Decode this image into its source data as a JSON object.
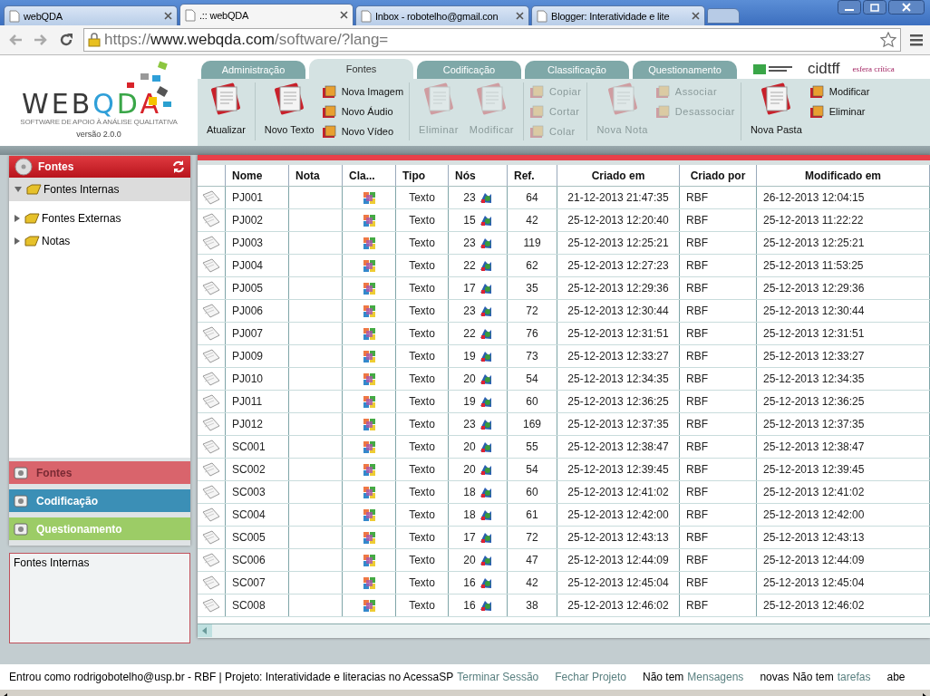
{
  "browser": {
    "tabs": [
      {
        "title": "webQDA",
        "selected": false
      },
      {
        "title": ".:: webQDA",
        "selected": true
      },
      {
        "title": "Inbox - robotelho@gmail.con",
        "selected": false
      },
      {
        "title": "Blogger: Interatividade e lite",
        "selected": false
      }
    ],
    "url": {
      "scheme": "https://",
      "host": "www.webqda.com",
      "path": "/software/?lang="
    }
  },
  "app": {
    "logo": {
      "letters": [
        {
          "text": "WEB",
          "color": "#3a3a3a"
        },
        {
          "text": "Q",
          "color": "#2f9fd8"
        },
        {
          "text": "D",
          "color": "#3aa648"
        },
        {
          "text": "A",
          "color": "#d8232a"
        }
      ],
      "subtitle": "SOFTWARE DE APOIO À ANÁLISE QUALITATIVA",
      "version": "versão 2.0.0"
    },
    "tabs": [
      {
        "label": "Administração",
        "selected": false
      },
      {
        "label": "Fontes",
        "selected": true
      },
      {
        "label": "Codificação",
        "selected": false
      },
      {
        "label": "Classificação",
        "selected": false
      },
      {
        "label": "Questionamento",
        "selected": false
      }
    ],
    "toolbar": [
      {
        "items": [
          {
            "kind": "large",
            "label": "Atualizar",
            "disabled": false
          }
        ]
      },
      {
        "items": [
          {
            "kind": "large",
            "label": "Novo Texto",
            "disabled": false
          },
          {
            "kind": "stack",
            "buttons": [
              {
                "label": "Nova Imagem",
                "disabled": false
              },
              {
                "label": "Novo Áudio",
                "disabled": false
              },
              {
                "label": "Novo Vídeo",
                "disabled": false
              }
            ]
          }
        ]
      },
      {
        "items": [
          {
            "kind": "large",
            "label": "Eliminar",
            "disabled": true
          },
          {
            "kind": "large",
            "label": "Modificar",
            "disabled": true
          }
        ]
      },
      {
        "items": [
          {
            "kind": "stack",
            "buttons": [
              {
                "label": "Copiar",
                "disabled": true
              },
              {
                "label": "Cortar",
                "disabled": true
              },
              {
                "label": "Colar",
                "disabled": true
              }
            ]
          }
        ]
      },
      {
        "items": [
          {
            "kind": "large",
            "label": "Nova Nota",
            "disabled": true
          },
          {
            "kind": "stack",
            "buttons": [
              {
                "label": "Associar",
                "disabled": true
              },
              {
                "label": "Desassociar",
                "disabled": true
              }
            ]
          }
        ]
      },
      {
        "items": [
          {
            "kind": "large",
            "label": "Nova Pasta",
            "disabled": false
          },
          {
            "kind": "stack",
            "buttons": [
              {
                "label": "Modificar",
                "disabled": false
              },
              {
                "label": "Eliminar",
                "disabled": false
              }
            ]
          }
        ]
      }
    ],
    "partners": [
      "cidtff",
      "esfera crítica"
    ]
  },
  "sidebar": {
    "panel": {
      "title": "Fontes"
    },
    "tree": [
      {
        "label": "Fontes Internas",
        "selected": true,
        "expanded": true
      },
      {
        "label": "Fontes Externas",
        "selected": false,
        "expanded": false
      },
      {
        "label": "Notas",
        "selected": false,
        "expanded": false
      }
    ],
    "accordion": [
      {
        "label": "Fontes",
        "color": "#d9646c",
        "active": true
      },
      {
        "label": "Codificação",
        "color": "#3b8fb6",
        "active": false
      },
      {
        "label": "Questionamento",
        "color": "#9ccc66",
        "active": false
      }
    ],
    "info": "Fontes Internas"
  },
  "table": {
    "columns": [
      "Nome",
      "Nota",
      "Cla...",
      "Tipo",
      "Nós",
      "Ref.",
      "Criado em",
      "Criado por",
      "Modificado em"
    ],
    "rows": [
      {
        "nome": "PJ001",
        "nota": "",
        "tipo": "Texto",
        "nos": "23",
        "ref": "64",
        "criado_em": "21-12-2013 21:47:35",
        "criado_por": "RBF",
        "modificado_em": "26-12-2013 12:04:15"
      },
      {
        "nome": "PJ002",
        "nota": "",
        "tipo": "Texto",
        "nos": "15",
        "ref": "42",
        "criado_em": "25-12-2013 12:20:40",
        "criado_por": "RBF",
        "modificado_em": "25-12-2013 11:22:22"
      },
      {
        "nome": "PJ003",
        "nota": "",
        "tipo": "Texto",
        "nos": "23",
        "ref": "119",
        "criado_em": "25-12-2013 12:25:21",
        "criado_por": "RBF",
        "modificado_em": "25-12-2013 12:25:21"
      },
      {
        "nome": "PJ004",
        "nota": "",
        "tipo": "Texto",
        "nos": "22",
        "ref": "62",
        "criado_em": "25-12-2013 12:27:23",
        "criado_por": "RBF",
        "modificado_em": "25-12-2013 11:53:25"
      },
      {
        "nome": "PJ005",
        "nota": "",
        "tipo": "Texto",
        "nos": "17",
        "ref": "35",
        "criado_em": "25-12-2013 12:29:36",
        "criado_por": "RBF",
        "modificado_em": "25-12-2013 12:29:36"
      },
      {
        "nome": "PJ006",
        "nota": "",
        "tipo": "Texto",
        "nos": "23",
        "ref": "72",
        "criado_em": "25-12-2013 12:30:44",
        "criado_por": "RBF",
        "modificado_em": "25-12-2013 12:30:44"
      },
      {
        "nome": "PJ007",
        "nota": "",
        "tipo": "Texto",
        "nos": "22",
        "ref": "76",
        "criado_em": "25-12-2013 12:31:51",
        "criado_por": "RBF",
        "modificado_em": "25-12-2013 12:31:51"
      },
      {
        "nome": "PJ009",
        "nota": "",
        "tipo": "Texto",
        "nos": "19",
        "ref": "73",
        "criado_em": "25-12-2013 12:33:27",
        "criado_por": "RBF",
        "modificado_em": "25-12-2013 12:33:27"
      },
      {
        "nome": "PJ010",
        "nota": "",
        "tipo": "Texto",
        "nos": "20",
        "ref": "54",
        "criado_em": "25-12-2013 12:34:35",
        "criado_por": "RBF",
        "modificado_em": "25-12-2013 12:34:35"
      },
      {
        "nome": "PJ011",
        "nota": "",
        "tipo": "Texto",
        "nos": "19",
        "ref": "60",
        "criado_em": "25-12-2013 12:36:25",
        "criado_por": "RBF",
        "modificado_em": "25-12-2013 12:36:25"
      },
      {
        "nome": "PJ012",
        "nota": "",
        "tipo": "Texto",
        "nos": "23",
        "ref": "169",
        "criado_em": "25-12-2013 12:37:35",
        "criado_por": "RBF",
        "modificado_em": "25-12-2013 12:37:35"
      },
      {
        "nome": "SC001",
        "nota": "",
        "tipo": "Texto",
        "nos": "20",
        "ref": "55",
        "criado_em": "25-12-2013 12:38:47",
        "criado_por": "RBF",
        "modificado_em": "25-12-2013 12:38:47"
      },
      {
        "nome": "SC002",
        "nota": "",
        "tipo": "Texto",
        "nos": "20",
        "ref": "54",
        "criado_em": "25-12-2013 12:39:45",
        "criado_por": "RBF",
        "modificado_em": "25-12-2013 12:39:45"
      },
      {
        "nome": "SC003",
        "nota": "",
        "tipo": "Texto",
        "nos": "18",
        "ref": "60",
        "criado_em": "25-12-2013 12:41:02",
        "criado_por": "RBF",
        "modificado_em": "25-12-2013 12:41:02"
      },
      {
        "nome": "SC004",
        "nota": "",
        "tipo": "Texto",
        "nos": "18",
        "ref": "61",
        "criado_em": "25-12-2013 12:42:00",
        "criado_por": "RBF",
        "modificado_em": "25-12-2013 12:42:00"
      },
      {
        "nome": "SC005",
        "nota": "",
        "tipo": "Texto",
        "nos": "17",
        "ref": "72",
        "criado_em": "25-12-2013 12:43:13",
        "criado_por": "RBF",
        "modificado_em": "25-12-2013 12:43:13"
      },
      {
        "nome": "SC006",
        "nota": "",
        "tipo": "Texto",
        "nos": "20",
        "ref": "47",
        "criado_em": "25-12-2013 12:44:09",
        "criado_por": "RBF",
        "modificado_em": "25-12-2013 12:44:09"
      },
      {
        "nome": "SC007",
        "nota": "",
        "tipo": "Texto",
        "nos": "16",
        "ref": "42",
        "criado_em": "25-12-2013 12:45:04",
        "criado_por": "RBF",
        "modificado_em": "25-12-2013 12:45:04"
      },
      {
        "nome": "SC008",
        "nota": "",
        "tipo": "Texto",
        "nos": "16",
        "ref": "38",
        "criado_em": "25-12-2013 12:46:02",
        "criado_por": "RBF",
        "modificado_em": "25-12-2013 12:46:02"
      }
    ]
  },
  "status_bar": [
    {
      "text": "Entrou como rodrigobotelho@usp.br - RBF | Projeto: Interatividade e literacias no AcessaSP",
      "link": false
    },
    {
      "text": "Terminar Sessão",
      "link": true
    },
    {
      "text": "Fechar Projeto",
      "link": true
    },
    {
      "text": "Não tem",
      "link": false
    },
    {
      "text": "Mensagens",
      "link": true
    },
    {
      "text": "novas",
      "link": false
    },
    {
      "text": "Não tem",
      "link": false
    },
    {
      "text": "tarefas",
      "link": true
    },
    {
      "text": "abe",
      "link": false
    }
  ]
}
